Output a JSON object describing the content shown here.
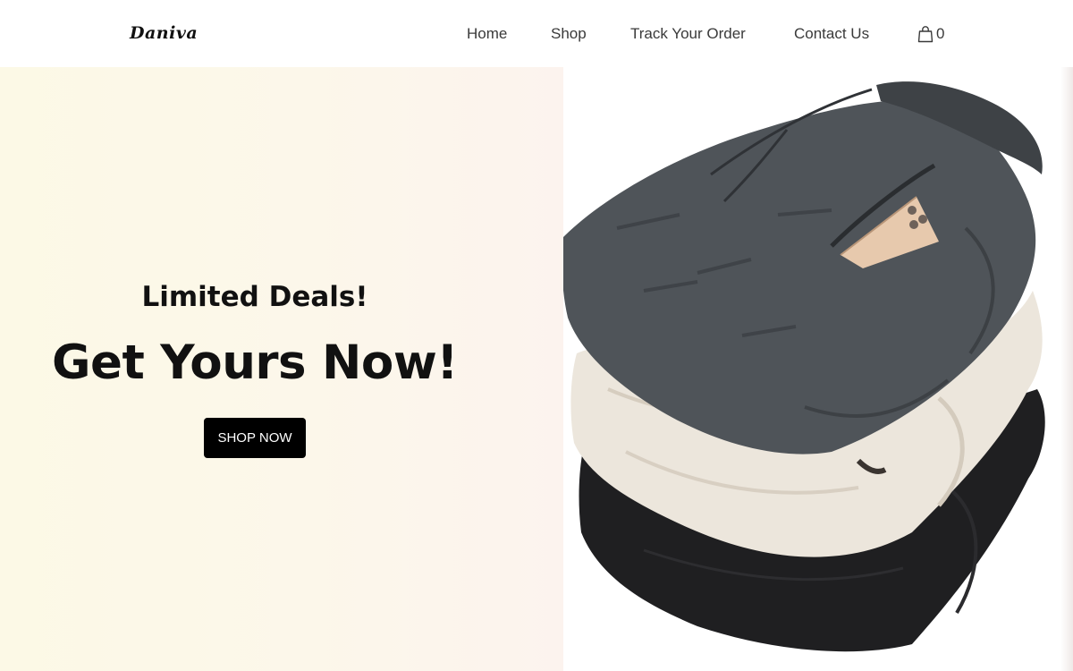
{
  "brand": {
    "logo_text": "Daniva"
  },
  "nav": {
    "items": [
      {
        "label": "Home"
      },
      {
        "label": "Shop"
      },
      {
        "label": "Track Your Order"
      },
      {
        "label": "Contact Us"
      }
    ],
    "cart": {
      "icon": "shopping-bag-icon",
      "count": "0"
    }
  },
  "hero": {
    "eyebrow": "Limited Deals!",
    "headline": "Get Yours Now!",
    "cta_label": "SHOP NOW",
    "image": {
      "subject": "folded-sweatpants-stack"
    }
  },
  "colors": {
    "cta_background": "#000000",
    "cta_text": "#ffffff",
    "hero_bg_left": "#fcf9e6",
    "hero_bg_right": "#fcf3ee",
    "nav_text": "#3a3a3a"
  }
}
